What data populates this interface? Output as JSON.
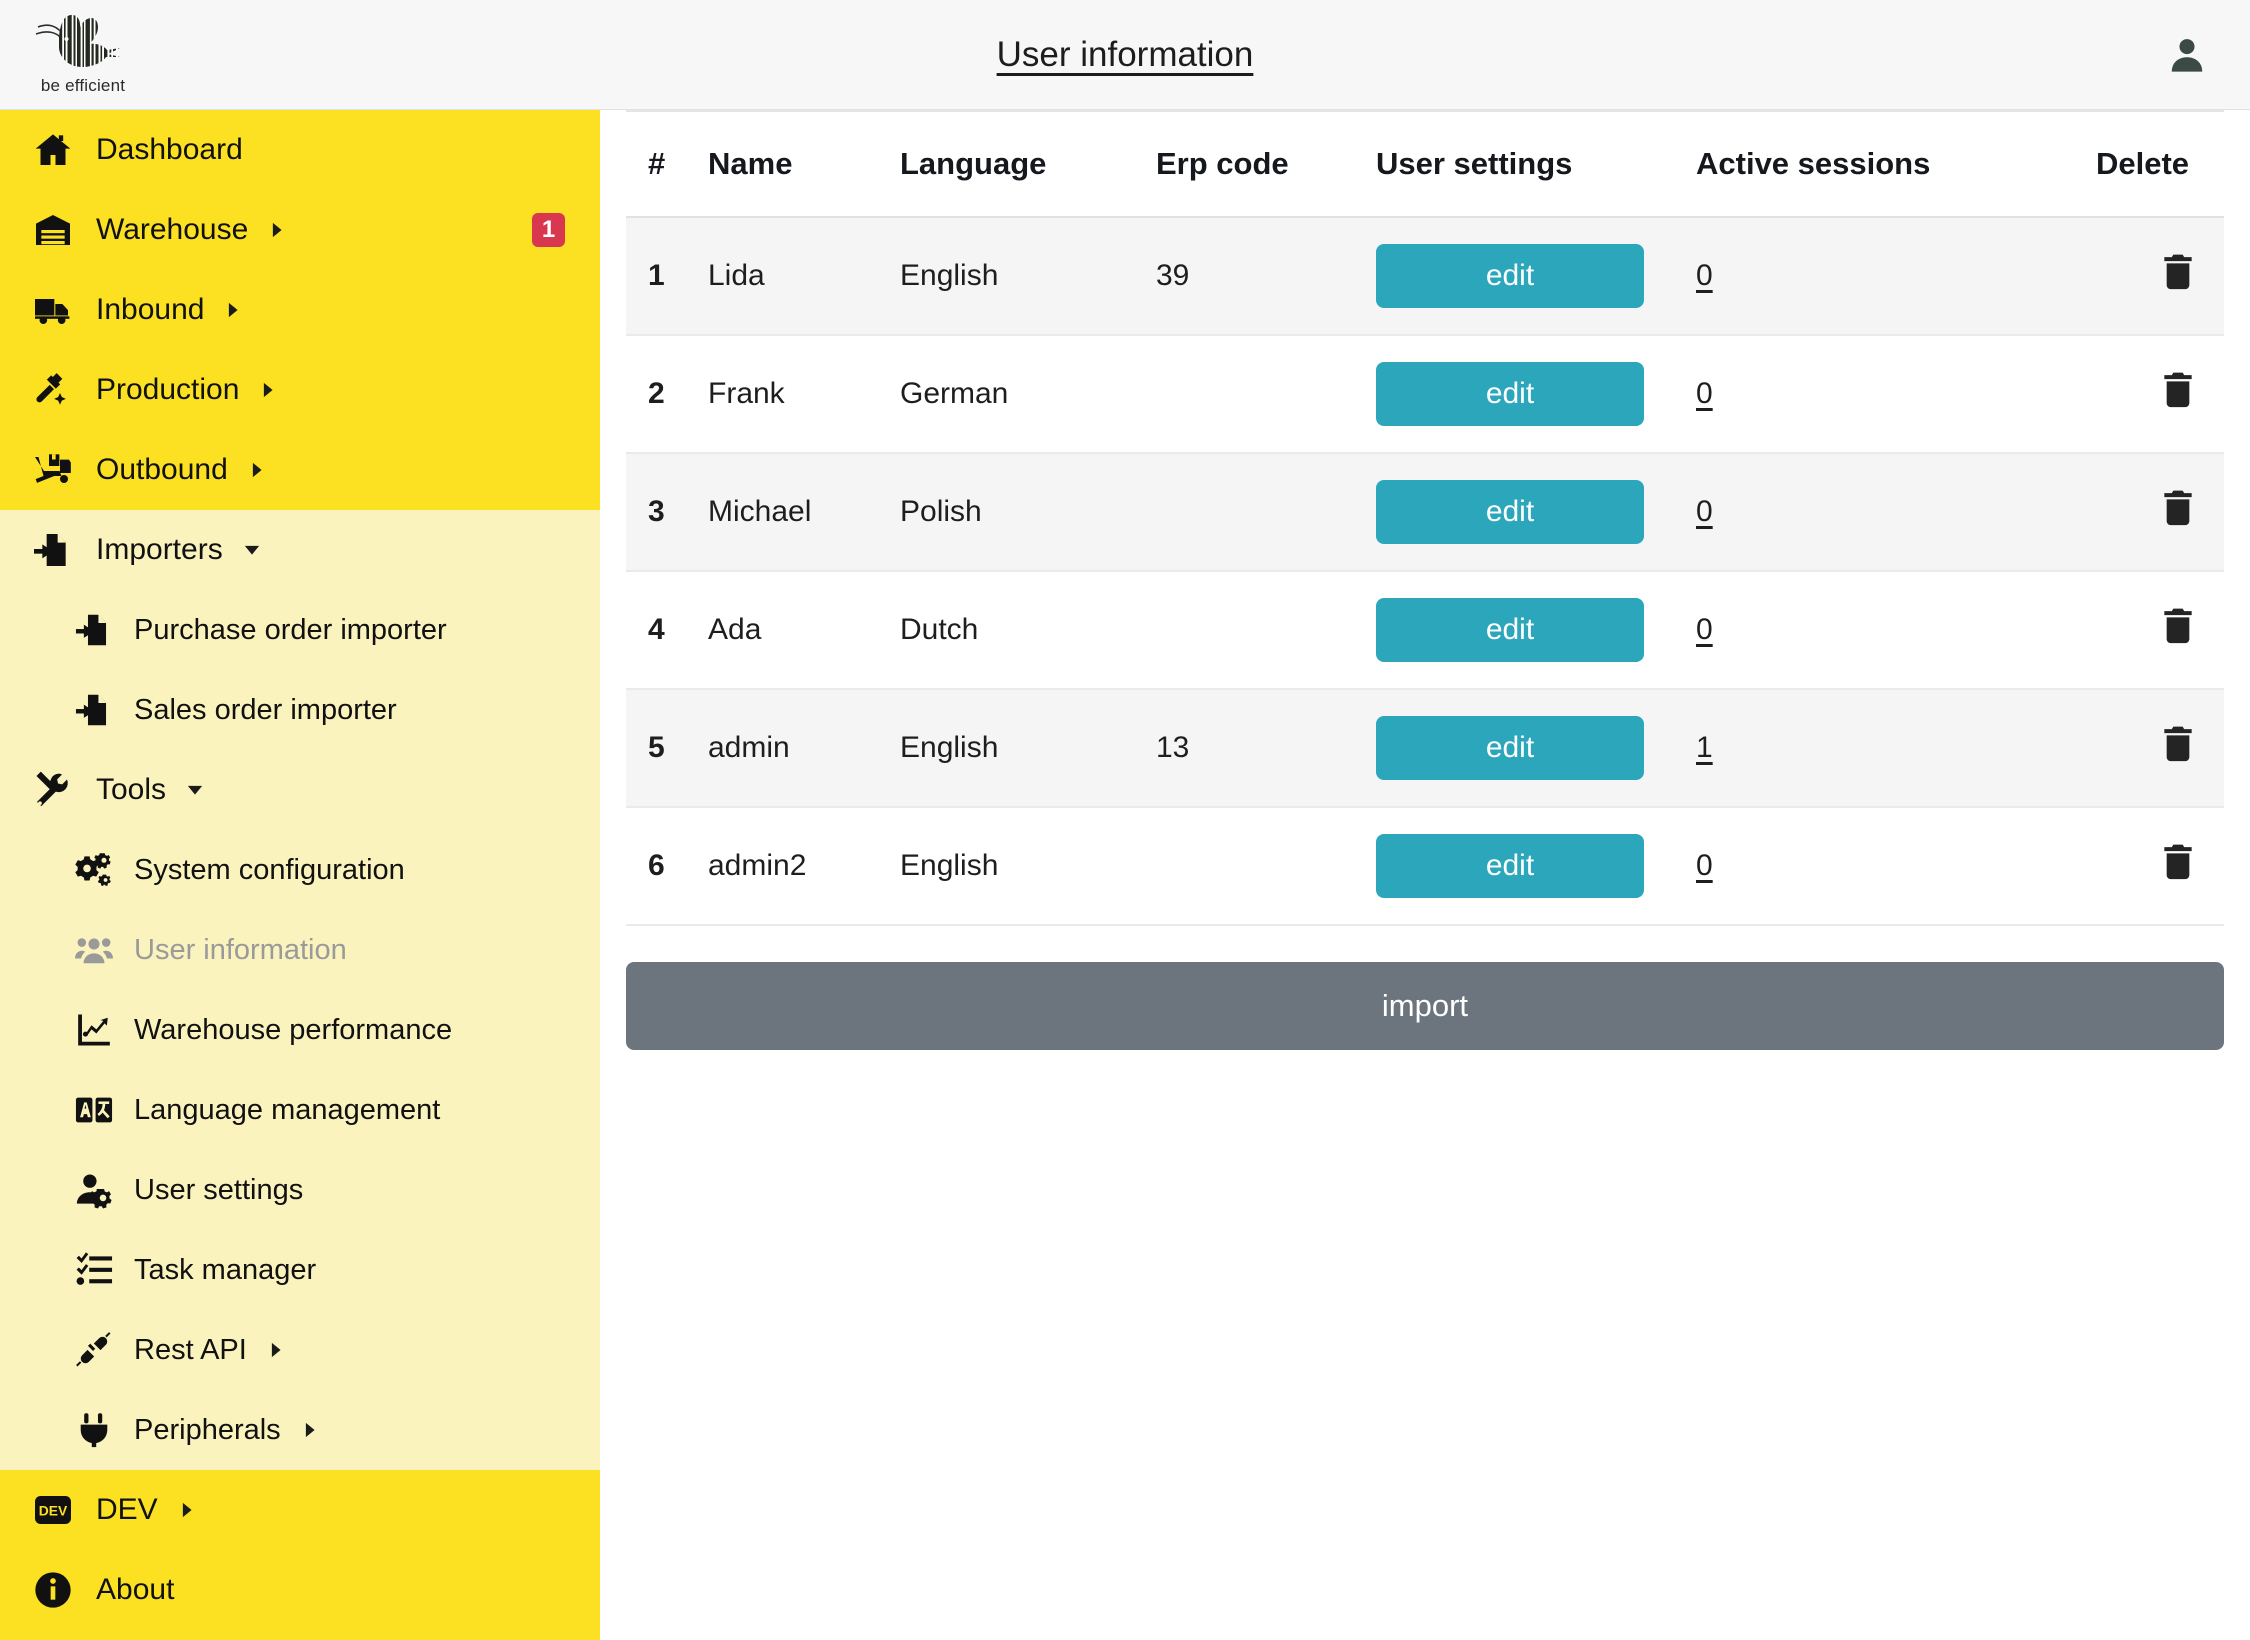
{
  "brand": {
    "tagline": "be efficient",
    "logo_icon": "bee-barcode-logo"
  },
  "header": {
    "title": "User information",
    "user_icon": "user-avatar-icon"
  },
  "sidebar": {
    "groups": [
      {
        "tone": "bright",
        "items": [
          {
            "label": "Dashboard",
            "icon": "home-icon",
            "level": 1,
            "caret": "",
            "badge": ""
          },
          {
            "label": "Warehouse",
            "icon": "warehouse-icon",
            "level": 1,
            "caret": "right",
            "badge": "1"
          },
          {
            "label": "Inbound",
            "icon": "truck-icon",
            "level": 1,
            "caret": "right",
            "badge": ""
          },
          {
            "label": "Production",
            "icon": "hammer-icon",
            "level": 1,
            "caret": "right",
            "badge": ""
          },
          {
            "label": "Outbound",
            "icon": "dolly-icon",
            "level": 1,
            "caret": "right",
            "badge": ""
          }
        ]
      },
      {
        "tone": "pale",
        "items": [
          {
            "label": "Importers",
            "icon": "import-file-icon",
            "level": 1,
            "caret": "down",
            "badge": ""
          },
          {
            "label": "Purchase order importer",
            "icon": "import-file-icon",
            "level": 2,
            "caret": "",
            "badge": ""
          },
          {
            "label": "Sales order importer",
            "icon": "import-file-icon",
            "level": 2,
            "caret": "",
            "badge": ""
          },
          {
            "label": "Tools",
            "icon": "tools-icon",
            "level": 1,
            "caret": "down",
            "badge": ""
          },
          {
            "label": "System configuration",
            "icon": "gears-icon",
            "level": 2,
            "caret": "",
            "badge": ""
          },
          {
            "label": "User information",
            "icon": "users-group-icon",
            "level": 2,
            "caret": "",
            "badge": "",
            "disabled": true
          },
          {
            "label": "Warehouse performance",
            "icon": "chart-line-icon",
            "level": 2,
            "caret": "",
            "badge": ""
          },
          {
            "label": "Language management",
            "icon": "translate-icon",
            "level": 2,
            "caret": "",
            "badge": ""
          },
          {
            "label": "User settings",
            "icon": "user-gear-icon",
            "level": 2,
            "caret": "",
            "badge": ""
          },
          {
            "label": "Task manager",
            "icon": "checklist-icon",
            "level": 2,
            "caret": "",
            "badge": ""
          },
          {
            "label": "Rest API",
            "icon": "plug-connect-icon",
            "level": 2,
            "caret": "right",
            "badge": ""
          },
          {
            "label": "Peripherals",
            "icon": "plug-icon",
            "level": 2,
            "caret": "right",
            "badge": ""
          }
        ]
      },
      {
        "tone": "bottom",
        "items": [
          {
            "label": "DEV",
            "icon": "dev-badge-icon",
            "level": 1,
            "caret": "right",
            "badge": ""
          },
          {
            "label": "About",
            "icon": "info-icon",
            "level": 1,
            "caret": "",
            "badge": ""
          }
        ]
      }
    ]
  },
  "main": {
    "table": {
      "columns": [
        "#",
        "Name",
        "Language",
        "Erp code",
        "User settings",
        "Active sessions",
        "Delete"
      ],
      "rows": [
        {
          "idx": "1",
          "name": "Lida",
          "language": "English",
          "erp_code": "39",
          "edit_label": "edit",
          "sessions": "0",
          "delete_icon": "trash-icon"
        },
        {
          "idx": "2",
          "name": "Frank",
          "language": "German",
          "erp_code": "",
          "edit_label": "edit",
          "sessions": "0",
          "delete_icon": "trash-icon"
        },
        {
          "idx": "3",
          "name": "Michael",
          "language": "Polish",
          "erp_code": "",
          "edit_label": "edit",
          "sessions": "0",
          "delete_icon": "trash-icon"
        },
        {
          "idx": "4",
          "name": "Ada",
          "language": "Dutch",
          "erp_code": "",
          "edit_label": "edit",
          "sessions": "0",
          "delete_icon": "trash-icon"
        },
        {
          "idx": "5",
          "name": "admin",
          "language": "English",
          "erp_code": "13",
          "edit_label": "edit",
          "sessions": "1",
          "delete_icon": "trash-icon"
        },
        {
          "idx": "6",
          "name": "admin2",
          "language": "English",
          "erp_code": "",
          "edit_label": "edit",
          "sessions": "0",
          "delete_icon": "trash-icon"
        }
      ]
    },
    "import_label": "import"
  },
  "colors": {
    "sidebar_bright": "#fbe122",
    "sidebar_pale": "#fbf3bd",
    "accent_edit": "#2ba6bb",
    "import_bar": "#6c757d",
    "badge_red": "#d9364f"
  }
}
